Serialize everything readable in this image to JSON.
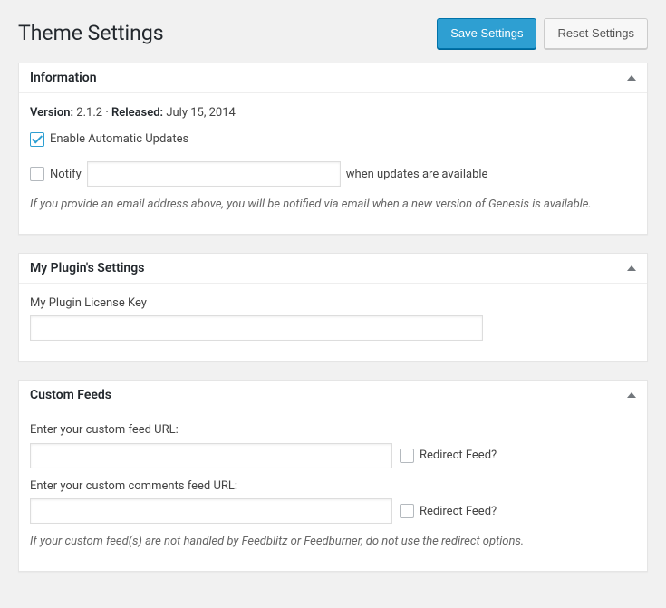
{
  "header": {
    "title": "Theme Settings",
    "save_label": "Save Settings",
    "reset_label": "Reset Settings"
  },
  "information": {
    "title": "Information",
    "version_label": "Version:",
    "version_value": "2.1.2",
    "separator": "·",
    "released_label": "Released:",
    "released_value": "July 15, 2014",
    "auto_updates_label": "Enable Automatic Updates",
    "auto_updates_checked": true,
    "notify_label": "Notify",
    "notify_value": "",
    "notify_suffix": "when updates are available",
    "notify_checked": false,
    "description": "If you provide an email address above, you will be notified via email when a new version of Genesis is available."
  },
  "my_plugin": {
    "title": "My Plugin's Settings",
    "license_label": "My Plugin License Key",
    "license_value": ""
  },
  "custom_feeds": {
    "title": "Custom Feeds",
    "feed_url_label": "Enter your custom feed URL:",
    "feed_url_value": "",
    "redirect_feed_label": "Redirect Feed?",
    "redirect_feed_checked": false,
    "comments_feed_url_label": "Enter your custom comments feed URL:",
    "comments_feed_url_value": "",
    "redirect_comments_feed_label": "Redirect Feed?",
    "redirect_comments_feed_checked": false,
    "description": "If your custom feed(s) are not handled by Feedblitz or Feedburner, do not use the redirect options."
  }
}
